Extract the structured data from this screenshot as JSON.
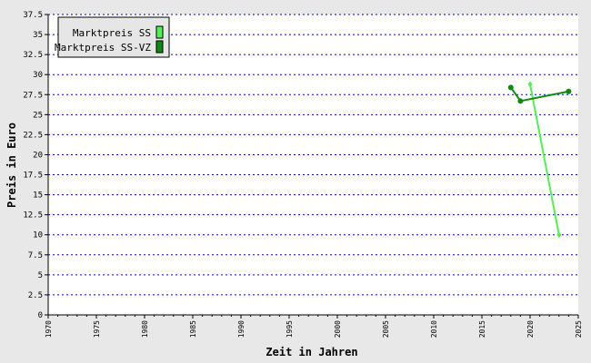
{
  "chart_data": {
    "type": "line",
    "xlabel": "Zeit in Jahren",
    "ylabel": "Preis in Euro",
    "xlim": [
      1970,
      2025
    ],
    "ylim": [
      0,
      37.5
    ],
    "x_ticks": [
      "1970",
      "1975",
      "1980",
      "1985",
      "1990",
      "1995",
      "2000",
      "2005",
      "2010",
      "2015",
      "2020",
      "2025"
    ],
    "y_ticks": [
      "0",
      "2.5",
      "5",
      "7.5",
      "10",
      "12.5",
      "15",
      "17.5",
      "20",
      "22.5",
      "25",
      "27.5",
      "30",
      "32.5",
      "35",
      "37.5"
    ],
    "grid": true,
    "legend_position": "top-left",
    "series": [
      {
        "name": "Marktpreis SS",
        "color": "#55ee55",
        "marker": "diamond",
        "points": [
          {
            "x": 2020,
            "y": 28.8
          },
          {
            "x": 2023,
            "y": 10.0
          }
        ]
      },
      {
        "name": "Marktpreis SS-VZ",
        "color": "#118811",
        "marker": "circle",
        "points": [
          {
            "x": 2018,
            "y": 28.4
          },
          {
            "x": 2019,
            "y": 26.7
          },
          {
            "x": 2024,
            "y": 27.9
          }
        ]
      }
    ]
  },
  "colors": {
    "background": "#e8e8e8",
    "plot_background": "#ffffff",
    "grid": "#0000cc",
    "axis": "#000000"
  }
}
